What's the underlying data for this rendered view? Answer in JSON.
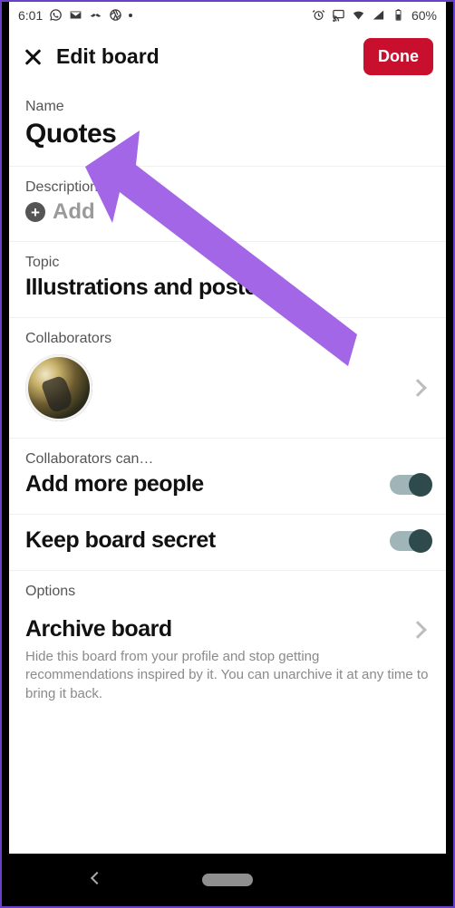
{
  "status": {
    "time": "6:01",
    "battery_text": "60%"
  },
  "header": {
    "title": "Edit board",
    "done_label": "Done"
  },
  "name": {
    "label": "Name",
    "value": "Quotes"
  },
  "description": {
    "label": "Description",
    "add_label": "Add"
  },
  "topic": {
    "label": "Topic",
    "value": "Illustrations and posters"
  },
  "collaborators": {
    "label": "Collaborators"
  },
  "perm": {
    "label": "Collaborators can…",
    "value": "Add more people"
  },
  "secret": {
    "label": "Keep board secret"
  },
  "options": {
    "label": "Options"
  },
  "archive": {
    "title": "Archive board",
    "desc": "Hide this board from your profile and stop getting recommendations inspired by it. You can unarchive it at any time to bring it back."
  }
}
